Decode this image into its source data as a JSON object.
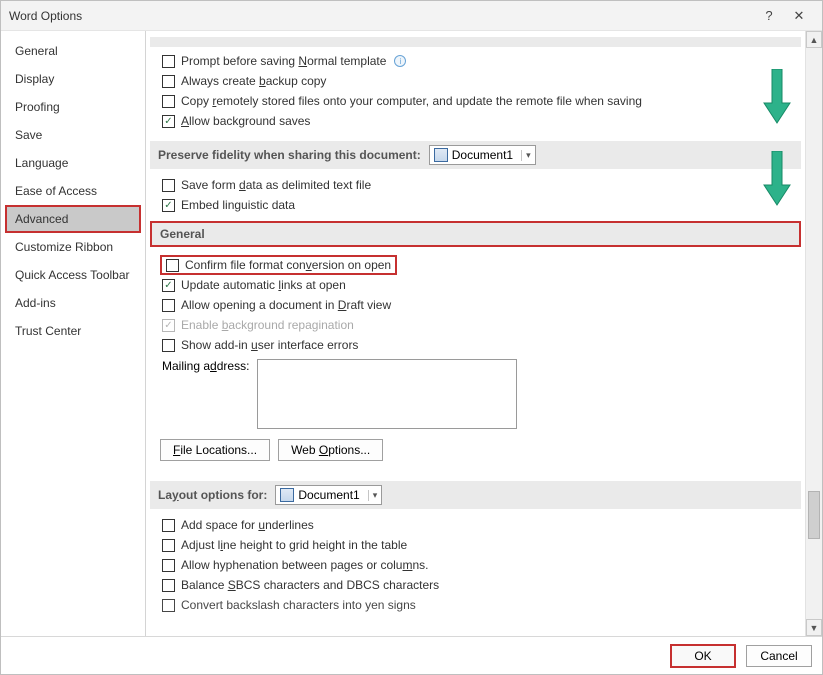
{
  "window": {
    "title": "Word Options"
  },
  "sidebar": {
    "items": [
      {
        "label": "General"
      },
      {
        "label": "Display"
      },
      {
        "label": "Proofing"
      },
      {
        "label": "Save"
      },
      {
        "label": "Language"
      },
      {
        "label": "Ease of Access"
      },
      {
        "label": "Advanced",
        "selected": true
      },
      {
        "label": "Customize Ribbon"
      },
      {
        "label": "Quick Access Toolbar"
      },
      {
        "label": "Add-ins"
      },
      {
        "label": "Trust Center"
      }
    ]
  },
  "save_section": {
    "rows": {
      "prompt_normal_pre": "Prompt before saving ",
      "prompt_normal_u": "N",
      "prompt_normal_post": "ormal template",
      "backup_pre": "Always create ",
      "backup_u": "b",
      "backup_post": "ackup copy",
      "remote_pre": "Copy ",
      "remote_u": "r",
      "remote_post": "emotely stored files onto your computer, and update the remote file when saving",
      "bg_save_u": "A",
      "bg_save_post": "llow background saves"
    }
  },
  "preserve": {
    "label": "Preserve fidelity when sharing this document:",
    "doc": "Document1",
    "save_form_pre": "Save form ",
    "save_form_u": "d",
    "save_form_post": "ata as delimited text file",
    "embed": "Embed linguistic data"
  },
  "general": {
    "header": "General",
    "confirm_pre": "Confirm file format con",
    "confirm_u": "v",
    "confirm_post": "ersion on open",
    "update_pre": "Update automatic ",
    "update_u": "l",
    "update_post": "inks at open",
    "draft_pre": "Allow opening a document in ",
    "draft_u": "D",
    "draft_post": "raft view",
    "repag_pre": "Enable ",
    "repag_u": "b",
    "repag_post": "ackground repagination",
    "addin_pre": "Show add-in ",
    "addin_u": "u",
    "addin_post": "ser interface errors",
    "mailing_pre": "Mailing a",
    "mailing_u": "d",
    "mailing_post": "dress:",
    "mailing_value": "",
    "file_loc_u": "F",
    "file_loc_post": "ile Locations...",
    "web_opt_pre": "Web ",
    "web_opt_u": "O",
    "web_opt_post": "ptions..."
  },
  "layout": {
    "label_pre": "La",
    "label_u": "y",
    "label_post": "out options for:",
    "doc": "Document1",
    "rows": {
      "underlines_pre": "Add space for ",
      "underlines_u": "u",
      "underlines_post": "nderlines",
      "adjust_pre": "Adjust l",
      "adjust_u": "i",
      "adjust_post": "ne height to grid height in the table",
      "hyphen_pre": "Allow hyphenation between pages or colu",
      "hyphen_u": "m",
      "hyphen_post": "ns.",
      "sbcs_pre": "Balance ",
      "sbcs_u": "S",
      "sbcs_post": "BCS characters and DBCS characters",
      "yen": "Convert backslash characters into yen signs"
    }
  },
  "footer": {
    "ok": "OK",
    "cancel": "Cancel"
  }
}
